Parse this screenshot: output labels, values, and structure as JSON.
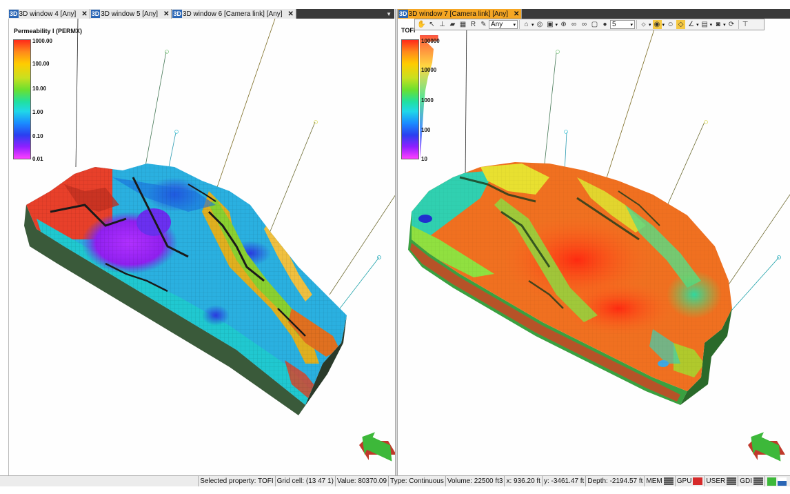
{
  "left_tabs": [
    {
      "badge": "3D",
      "label": "3D window 4 [Any]",
      "close": "✕"
    },
    {
      "badge": "3D",
      "label": "3D window 5 [Any]",
      "close": "✕"
    },
    {
      "badge": "3D",
      "label": "3D window 6 [Camera link]  [Any]",
      "close": "✕"
    }
  ],
  "right_tab": {
    "badge": "3D",
    "label": "3D window 7 [Camera link]  [Any]",
    "close": "✕"
  },
  "left_view": {
    "legend_title": "Permeability I (PERMX)",
    "legend_ticks": [
      "1000.00",
      "100.00",
      "10.00",
      "1.00",
      "0.10",
      "0.01"
    ]
  },
  "right_view": {
    "legend_title": "TOFI",
    "legend_ticks": [
      "100000",
      "10000",
      "1000",
      "100",
      "10"
    ]
  },
  "toolbar": {
    "filter_select": "Any",
    "number_select": "5"
  },
  "status": {
    "selected_property": "Selected property: TOFI",
    "grid_cell": "Grid cell: (13 47 1)",
    "value": "Value: 80370.09",
    "type": "Type: Continuous",
    "volume": "Volume: 22500 ft3",
    "x": "x: 936.20 ft",
    "y": "y: -3461.47 ft",
    "depth": "Depth: -2194.57 ft",
    "mem": "MEM",
    "gpu": "GPU",
    "user": "USER",
    "gdi": "GDI"
  },
  "colors": {
    "tab_active": "#f5a623",
    "badge": "#2a66b5",
    "arrow_green": "#3db83a",
    "arrow_red": "#c0392b"
  },
  "icons": {
    "tab_dropdown": "▼",
    "dropdown_arrow": "▾"
  }
}
